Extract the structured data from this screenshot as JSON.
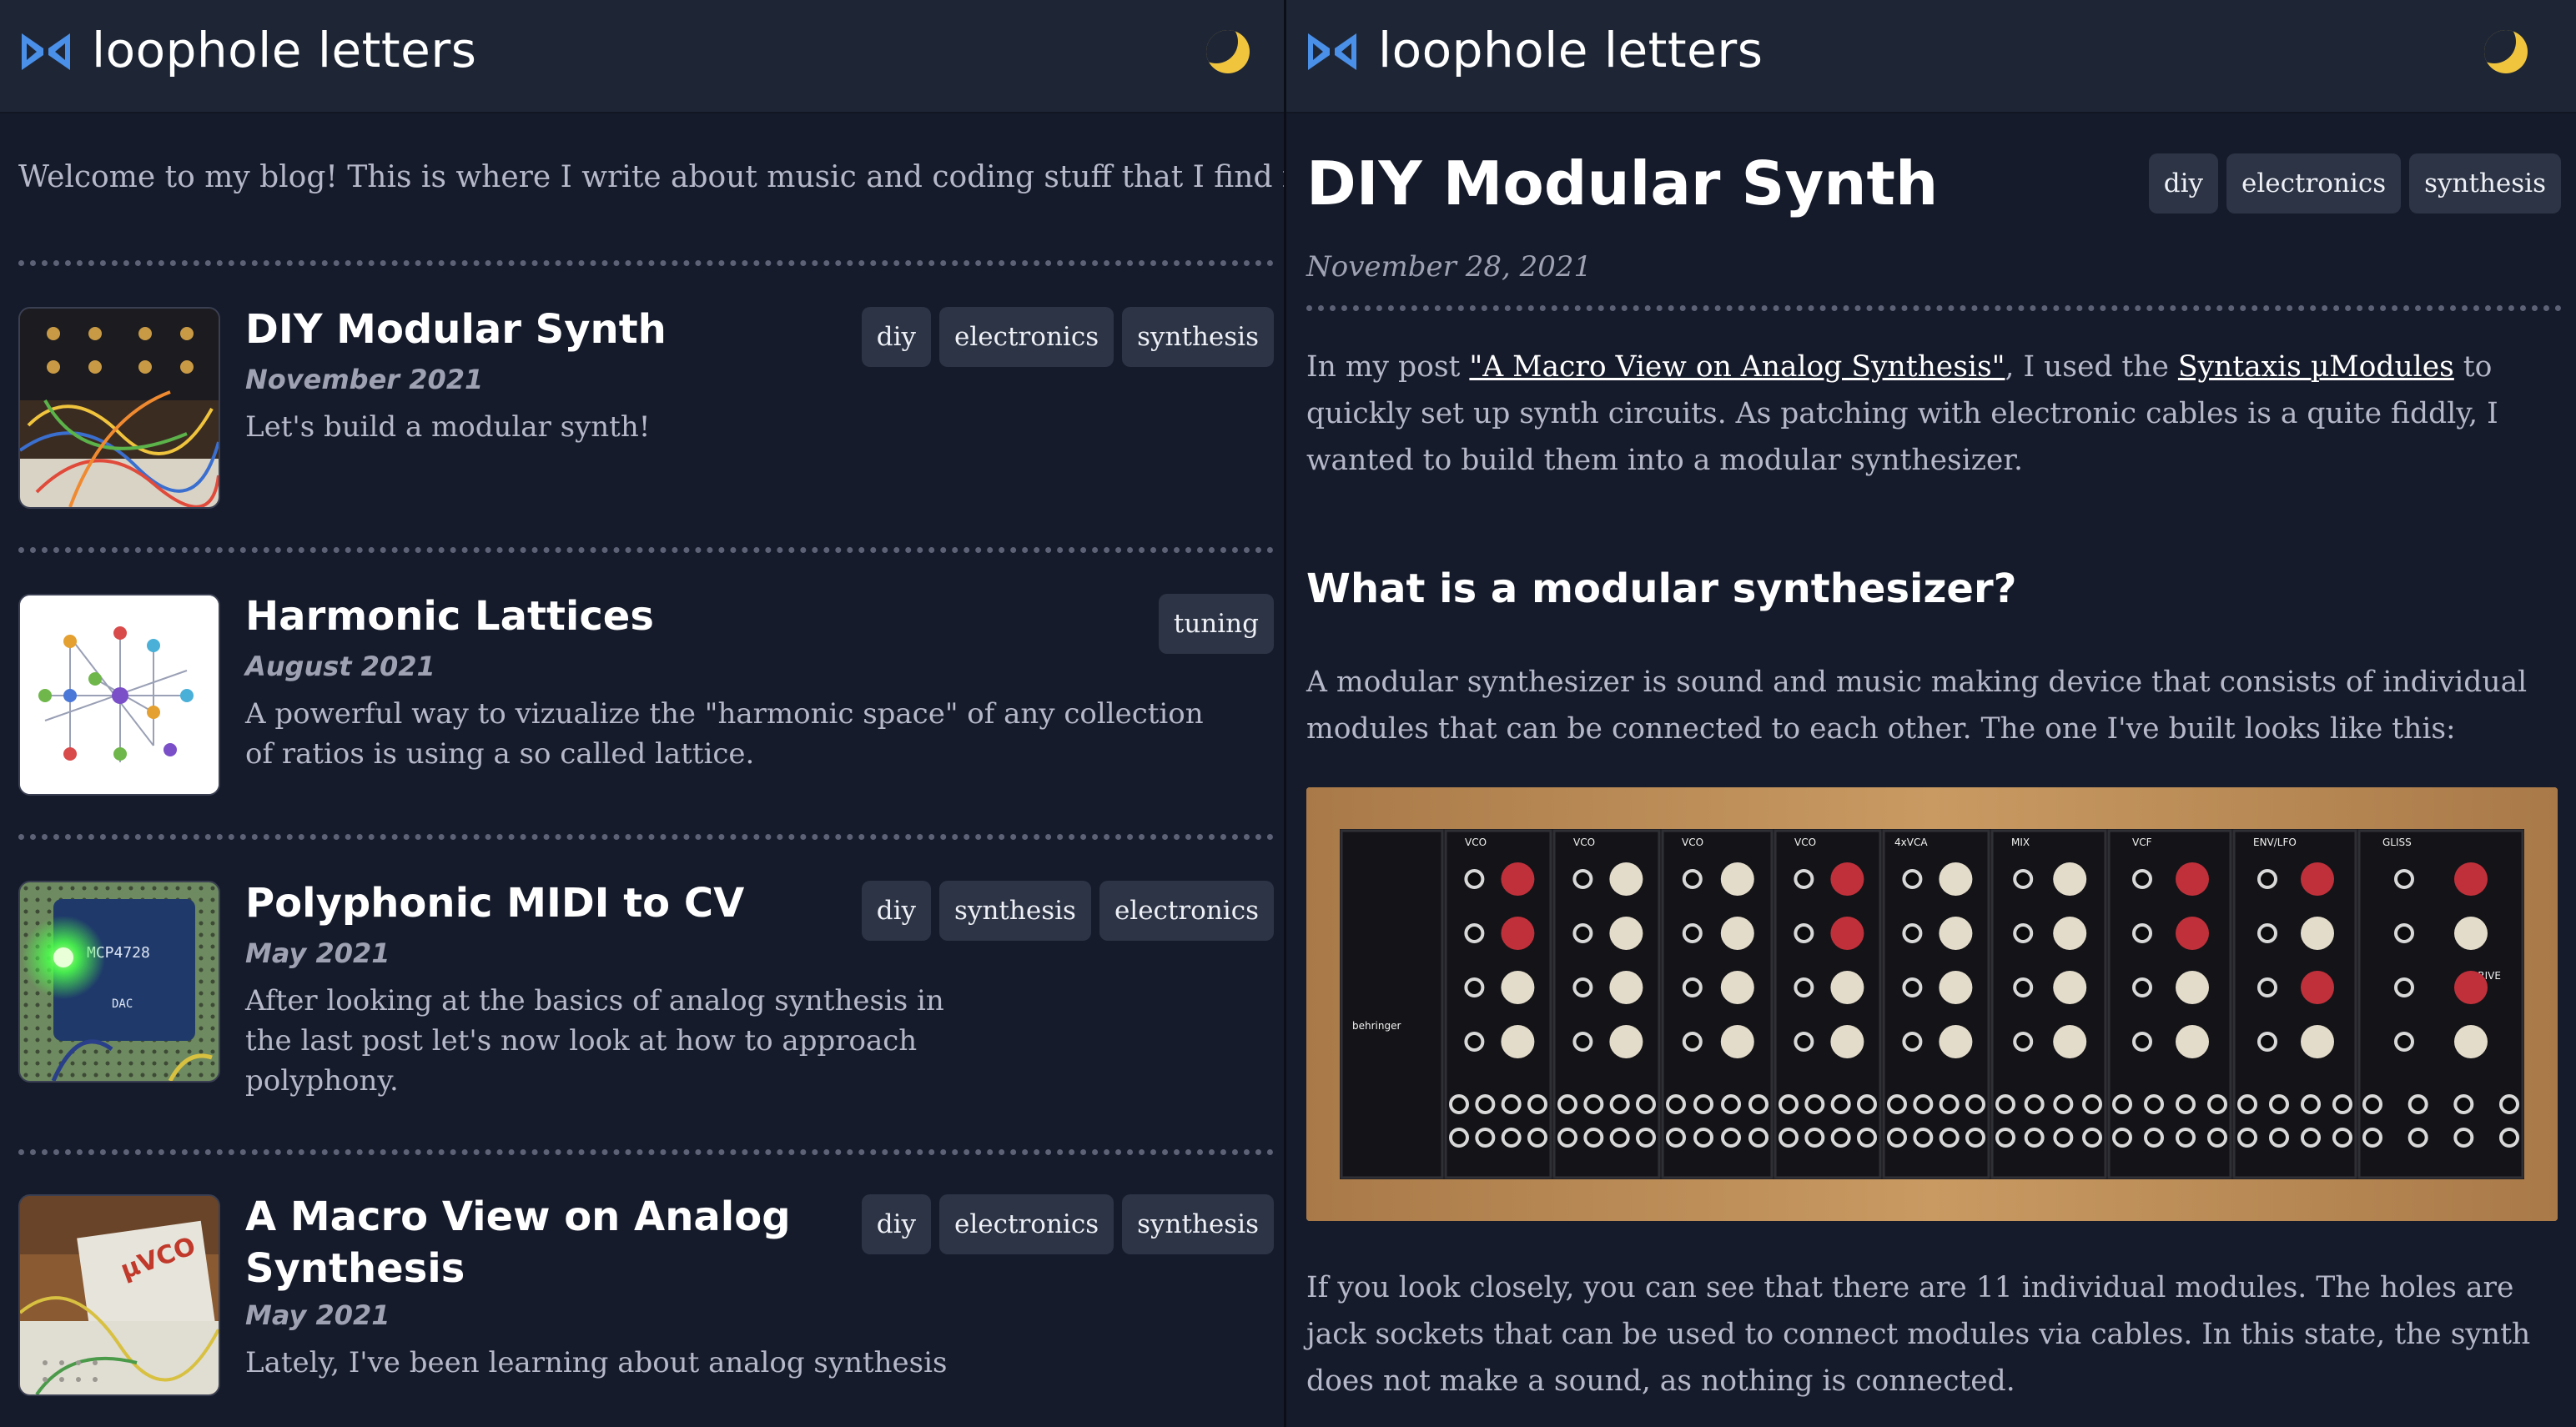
{
  "site": {
    "title": "loophole letters"
  },
  "icons": {
    "logo": "bowtie-logo-icon",
    "theme_toggle": "moon-icon"
  },
  "colors": {
    "background": "#161b2b",
    "header": "#1e2636",
    "tag_bg": "#2c3445",
    "accent_logo": "#4a8fe8",
    "moon": "#f0c43d"
  },
  "home": {
    "welcome": "Welcome to my blog! This is where I write about music and coding stuff that I find interesting.",
    "posts": [
      {
        "title": "DIY Modular Synth",
        "date": "November 2021",
        "description": "Let's build a modular synth!",
        "tags": [
          "diy",
          "electronics",
          "synthesis"
        ]
      },
      {
        "title": "Harmonic Lattices",
        "date": "August 2021",
        "description_lines": [
          "A powerful way to vizualize the \"harmonic space\" of any collection",
          "of ratios is using a so called lattice."
        ],
        "tags": [
          "tuning"
        ]
      },
      {
        "title": "Polyphonic MIDI to CV",
        "date": "May 2021",
        "description_lines": [
          "After looking at the basics of analog synthesis in",
          "the last post let's now look at how to approach",
          "polyphony."
        ],
        "tags": [
          "diy",
          "synthesis",
          "electronics"
        ],
        "thumb_labels": [
          "MCP4728",
          "DAC"
        ]
      },
      {
        "title_lines": [
          "A Macro View on Analog",
          "Synthesis"
        ],
        "date": "May 2021",
        "description": "Lately, I've been learning about analog synthesis",
        "tags": [
          "diy",
          "electronics",
          "synthesis"
        ],
        "thumb_labels": [
          "µVCO"
        ]
      }
    ]
  },
  "article": {
    "title": "DIY Modular Synth",
    "tags": [
      "diy",
      "electronics",
      "synthesis"
    ],
    "date": "November 28, 2021",
    "intro": {
      "t1": "In my post ",
      "link1": "\"A Macro View on Analog Synthesis\"",
      "t2": ", I used the ",
      "link2": "Syntaxis µModules",
      "t3": " to quickly set up synth circuits. As patching with electronic cables is a quite fiddly, I wanted to build them into a modular synthesizer."
    },
    "heading": "What is a modular synthesizer?",
    "para2": "A modular synthesizer is sound and music making device that consists of individual modules that can be connected to each other. The one I've built looks like this:",
    "photo_labels": [
      "VCO",
      "VCO",
      "VCO",
      "VCO",
      "4xVCA",
      "MIX",
      "VCF",
      "ENV/LFO",
      "GLISS",
      "DRIVE",
      "behringer"
    ],
    "para3": "If you look closely, you can see that there are 11 individual modules. The holes are jack sockets that can be used to connect modules via cables. In this state, the synth does not make a sound, as nothing is connected."
  }
}
